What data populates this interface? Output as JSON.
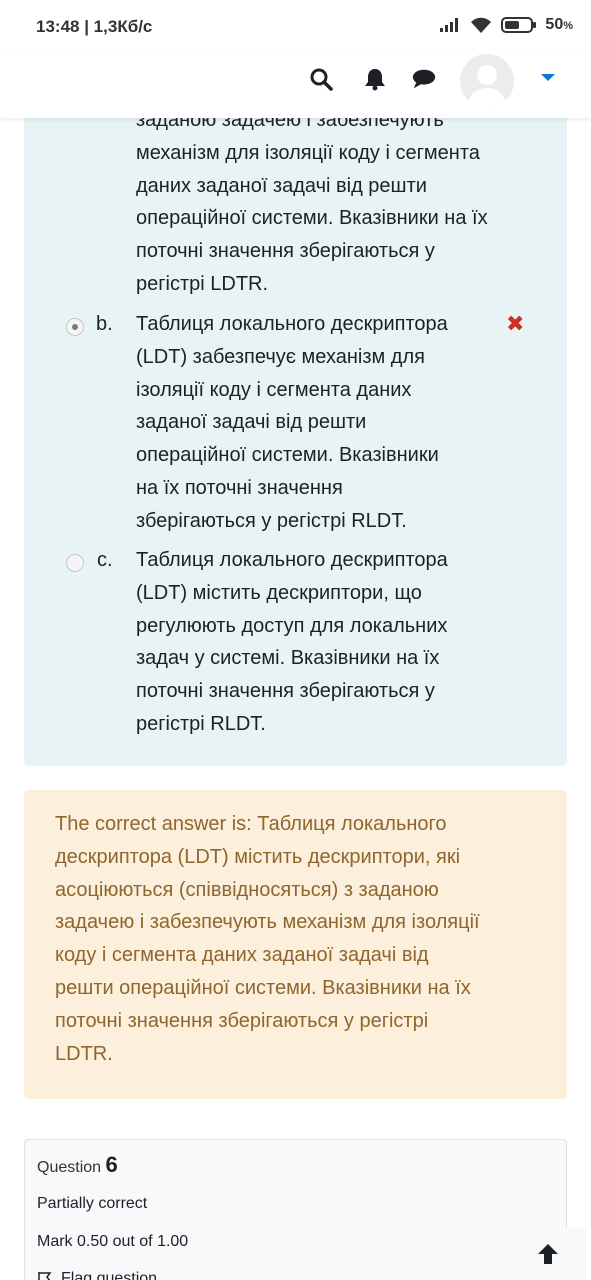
{
  "status": {
    "time_speed": "13:48 | 1,3Кб/с",
    "battery_pct": "50",
    "battery_unit": "%"
  },
  "navbar": {
    "icons": [
      "search-icon",
      "bell-icon",
      "chat-icon",
      "user-avatar",
      "chevron-down-icon"
    ]
  },
  "answers": {
    "option_a_partial": "заданою задачею і забезпечують механізм для ізоляції коду і сегмента даних заданої задачі від решти операційної системи. Вказівники на їх поточні значення зберігаються у регістрі LDTR.",
    "option_a_line1": "заданою задачею і забезпечують",
    "option_a_line2": "механізм для ізоляції коду і сегмента",
    "option_a_line3": "даних заданої задачі від решти",
    "option_a_line4": "операційної системи. Вказівники на їх",
    "option_a_line5": "поточні значення зберігаються у",
    "option_a_line6": "регістрі LDTR.",
    "option_b_letter": "b.",
    "option_b_lines": [
      "Таблиця локального дескриптора",
      "(LDT) забезпечує механізм для",
      "ізоляції коду і сегмента даних",
      "заданої задачі від решти",
      "операційної системи. Вказівники",
      "на їх поточні значення",
      "зберігаються у регістрі RLDT."
    ],
    "option_b_selected": true,
    "option_b_incorrect_mark": "✖",
    "option_c_letter": "c.",
    "option_c_lines": [
      "Таблиця локального дескриптора",
      "(LDT) містить дескриптори, що",
      "регулюють доступ для локальних",
      "задач у системі. Вказівники на їх",
      "поточні значення зберігаються у",
      "регістрі RLDT."
    ],
    "option_c_selected": false
  },
  "feedback": {
    "lines": [
      "The correct answer is: Таблиця локального",
      "дескриптора (LDT) містить дескриптори, які",
      "асоціюються (співвідносяться) з заданою",
      "задачею і забезпечують механізм для ізоляції",
      "коду і сегмента даних заданої задачі від",
      "решти операційної системи. Вказівники на їх",
      "поточні значення зберігаються у регістрі",
      "LDTR."
    ]
  },
  "question_info": {
    "label": "Question",
    "number": "6",
    "state": "Partially correct",
    "mark": "Mark 0.50 out of 1.00",
    "flag": "Flag question"
  },
  "colors": {
    "answer_bg": "#e7f3f5",
    "feedback_bg": "#fcefdc",
    "feedback_text": "#8e662e",
    "incorrect": "#ca3120",
    "accent": "#1177d1"
  }
}
